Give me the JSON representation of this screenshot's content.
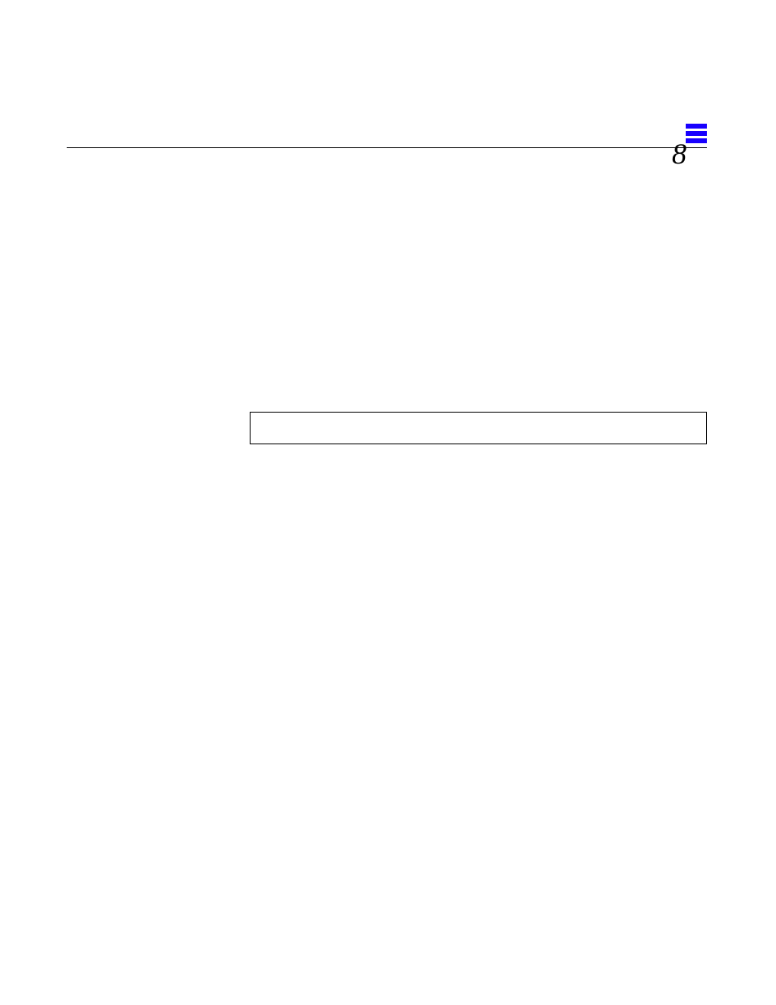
{
  "header": {
    "chapter_number": "8"
  },
  "icons": {
    "menu": "menu-icon"
  }
}
